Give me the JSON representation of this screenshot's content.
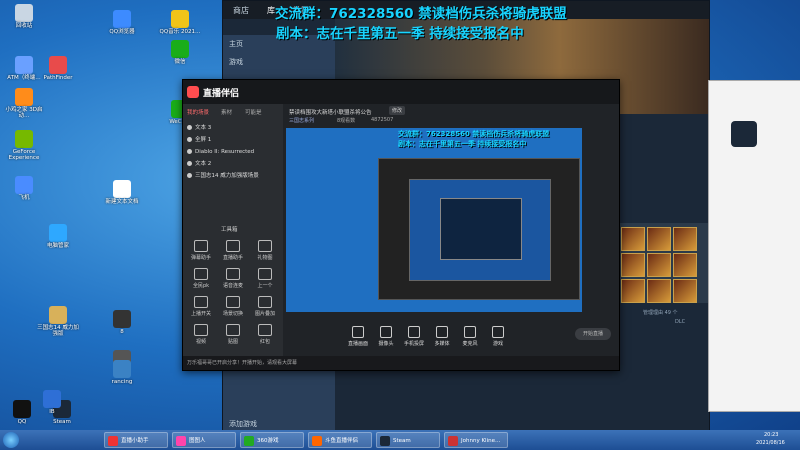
{
  "overlay": {
    "line1": "交流群：762328560   禁读档伤兵杀将骑虎联盟",
    "line2": "剧本：志在千里第五一季  持续接受报名中"
  },
  "desktop_icons": [
    {
      "label": "回收站",
      "color": "#c9d6e3"
    },
    {
      "label": "ATM（终端…",
      "color": "#6aa0ff"
    },
    {
      "label": "小鸡之家 3D启动…",
      "color": "#ff8c1a"
    },
    {
      "label": "GeForce Experience",
      "color": "#76b900"
    },
    {
      "label": "飞机",
      "color": "#4a8cff"
    },
    {
      "label": "PathFinder",
      "color": "#e84b4b"
    },
    {
      "label": "三国志14 威力加强版",
      "color": "#d8b15a"
    },
    {
      "label": "电脑管家",
      "color": "#2ea8ff"
    },
    {
      "label": "QQ浏览器",
      "color": "#3d8bff"
    },
    {
      "label": "QQ音乐 2021…",
      "color": "#f0c419"
    },
    {
      "label": "微信",
      "color": "#1aad19"
    },
    {
      "label": "WeChat",
      "color": "#1aad19"
    },
    {
      "label": "Steam",
      "color": "#1b2838"
    },
    {
      "label": "新建文本文档",
      "color": "#ffffff"
    },
    {
      "label": "8",
      "color": "#333333"
    },
    {
      "label": "RTSS",
      "color": "#555555"
    },
    {
      "label": "IB",
      "color": "#2e6fd6"
    },
    {
      "label": "QQ",
      "color": "#111111"
    },
    {
      "label": "rancing",
      "color": "#3b82c4"
    }
  ],
  "steam": {
    "nav": [
      "商店",
      "库",
      "社区"
    ],
    "home_label": "主页",
    "game_label": "游戏",
    "add_game": "添加游戏",
    "manage": "管理理由 49 个",
    "dlc": "DLC"
  },
  "live": {
    "app_name": "直播伴侣",
    "stream_title": "禁读档围攻大新塔小联盟杀将公告",
    "edit_btn": "修改",
    "category": "三国志系列",
    "viewers": "8观看数",
    "likes": "4872507",
    "tabs": [
      "我的场景",
      "素材",
      "可能是"
    ],
    "sources": [
      {
        "name": "文本 3"
      },
      {
        "name": "全屏 1"
      },
      {
        "name": "Diablo II: Resurrected"
      },
      {
        "name": "文本 2"
      },
      {
        "name": "三国志14 威力加强版场景"
      }
    ],
    "toolbox_title": "工具箱",
    "tools": [
      "弹幕助手",
      "直播助手",
      "礼物图",
      "全民pk",
      "语音连麦",
      "上一个",
      "上播开关",
      "场景切换",
      "图片叠加",
      "视频",
      "贴图",
      "红包"
    ],
    "controls": [
      "直播画面",
      "摄像头",
      "手机投屏",
      "多媒体",
      "麦克风",
      "游戏"
    ],
    "start_btn": "开始直播",
    "notice": "万乐福哥哥已开启分享！开播开始，请观看大屏幕"
  },
  "taskbar": {
    "items": [
      {
        "label": "直播小助手",
        "color": "#e33"
      },
      {
        "label": "图图人",
        "color": "#f4a"
      },
      {
        "label": "360游戏",
        "color": "#2a2"
      },
      {
        "label": "斗鱼直播伴侣",
        "color": "#f60"
      },
      {
        "label": "Steam",
        "color": "#1b2838"
      },
      {
        "label": "Johnny Kline…",
        "color": "#c33"
      }
    ],
    "time": "20:23",
    "date": "2021/08/16"
  },
  "colors": {
    "accent": "#18d4ff",
    "desktop": "#1f6fc1",
    "steam": "#1b2838",
    "live": "#202327"
  }
}
